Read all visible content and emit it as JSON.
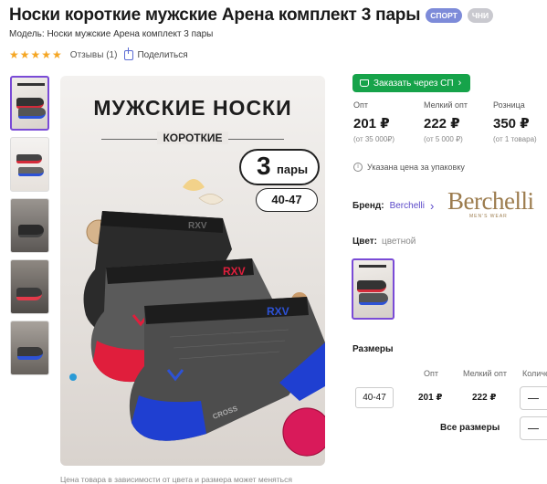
{
  "header": {
    "title": "Носки короткие мужские Арена комплект 3 пары",
    "badges": [
      "СПОРТ",
      "ЧНИ"
    ],
    "model": "Модель: Носки мужские Арена комплект 3 пары",
    "reviews": "Отзывы (1)",
    "share": "Поделиться"
  },
  "image": {
    "title": "МУЖСКИЕ НОСКИ",
    "subtitle": "КОРОТКИЕ",
    "pairs_number": "3",
    "pairs_text": "пары",
    "size_range": "40-47",
    "sock_brand": "RXV",
    "sock_text": "CROSS",
    "price_note": "Цена товара в зависимости от цвета и размера может меняться"
  },
  "order": {
    "sp_button": "Заказать через СП",
    "prices": [
      {
        "label": "Опт",
        "value": "201 ₽",
        "min": "(от 35 000₽)"
      },
      {
        "label": "Мелкий опт",
        "value": "222 ₽",
        "min": "(от 5 000 ₽)"
      },
      {
        "label": "Розница",
        "value": "350 ₽",
        "min": "(от 1 товара)"
      }
    ],
    "unit_note": "Указана цена за упаковку"
  },
  "brand": {
    "label": "Бренд:",
    "name": "Berchelli",
    "logo": "Berchelli",
    "logo_sub": "MEN'S WEAR"
  },
  "color": {
    "label": "Цвет:",
    "value": "цветной"
  },
  "sizes": {
    "title": "Размеры",
    "headers": [
      "Опт",
      "Мелкий опт",
      "Количе"
    ],
    "row": {
      "size": "40-47",
      "opt": "201 ₽",
      "small_opt": "222 ₽"
    },
    "all_sizes": "Все размеры"
  },
  "colors": {
    "accent": "#7a4bd6",
    "button": "#16a34a",
    "stars": "#f5a623",
    "brand_logo": "#9c7c4e"
  }
}
